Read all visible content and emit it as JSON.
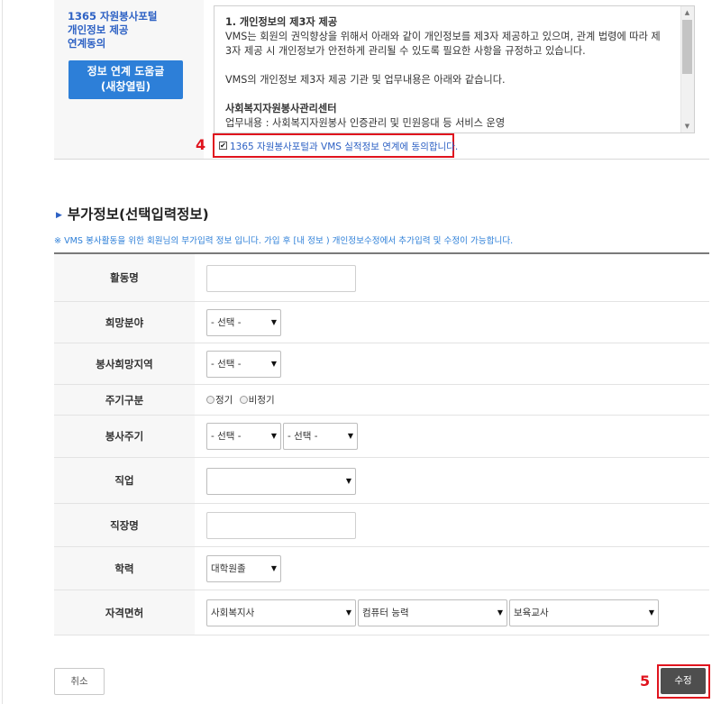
{
  "consent": {
    "title_lines": [
      "1365 자원봉사포털",
      "개인정보 제공",
      "연계동의"
    ],
    "help_button_lines": [
      "정보 연계 도움글",
      "(새창열림)"
    ],
    "terms": {
      "heading": "1. 개인정보의 제3자 제공",
      "para1_line1": "VMS는 회원의 권익향상을 위해서 아래와 같이 개인정보를 제3자 제공하고 있으며, 관계 법령에 따라 제",
      "para1_line2": "3자 제공 시 개인정보가 안전하게 관리될 수 있도록 필요한 사항을 규정하고 있습니다.",
      "para2": "VMS의 개인정보 제3자 제공 기관 및 업무내용은 아래와 같습니다.",
      "org_name": "사회복지자원봉사관리센터",
      "org_duty": "업무내용 : 사회복지자원봉사 인증관리 및 민원응대 등 서비스 운영"
    },
    "agree_checked_mark": "✔",
    "agree_label": "1365 자원봉사포털과 VMS 실적정보 연계에 동의합니다.",
    "step_marker": "4"
  },
  "additional": {
    "heading": "부가정보(선택입력정보)",
    "note": "※ VMS 봉사활동을 위한 회원님의 부가입력 정보 입니다. 가입 후 [내 정보 ) 개인정보수정에서 추가입력 및 수정이 가능합니다.",
    "fields": {
      "activity_name": {
        "label": "활동명",
        "value": ""
      },
      "desired_field": {
        "label": "희망분야",
        "selected": "- 선택 -"
      },
      "desired_region": {
        "label": "봉사희망지역",
        "selected": "- 선택 -"
      },
      "period_type": {
        "label": "주기구분",
        "option1": "정기",
        "option2": "비정기"
      },
      "service_cycle": {
        "label": "봉사주기",
        "selected1": "- 선택 -",
        "selected2": "- 선택 -"
      },
      "occupation": {
        "label": "직업",
        "selected": ""
      },
      "workplace": {
        "label": "직장명",
        "value": ""
      },
      "education": {
        "label": "학력",
        "selected": "대학원졸"
      },
      "certificates": {
        "label": "자격면허",
        "selected1": "사회복지사",
        "selected2": "컴퓨터 능력",
        "selected3": "보육교사"
      }
    }
  },
  "buttons": {
    "cancel": "취소",
    "submit": "수정",
    "step_marker": "5"
  },
  "colors": {
    "accent_blue": "#2d7fd8",
    "highlight_red": "#e0141e",
    "submit_bg": "#4e4e4e"
  }
}
